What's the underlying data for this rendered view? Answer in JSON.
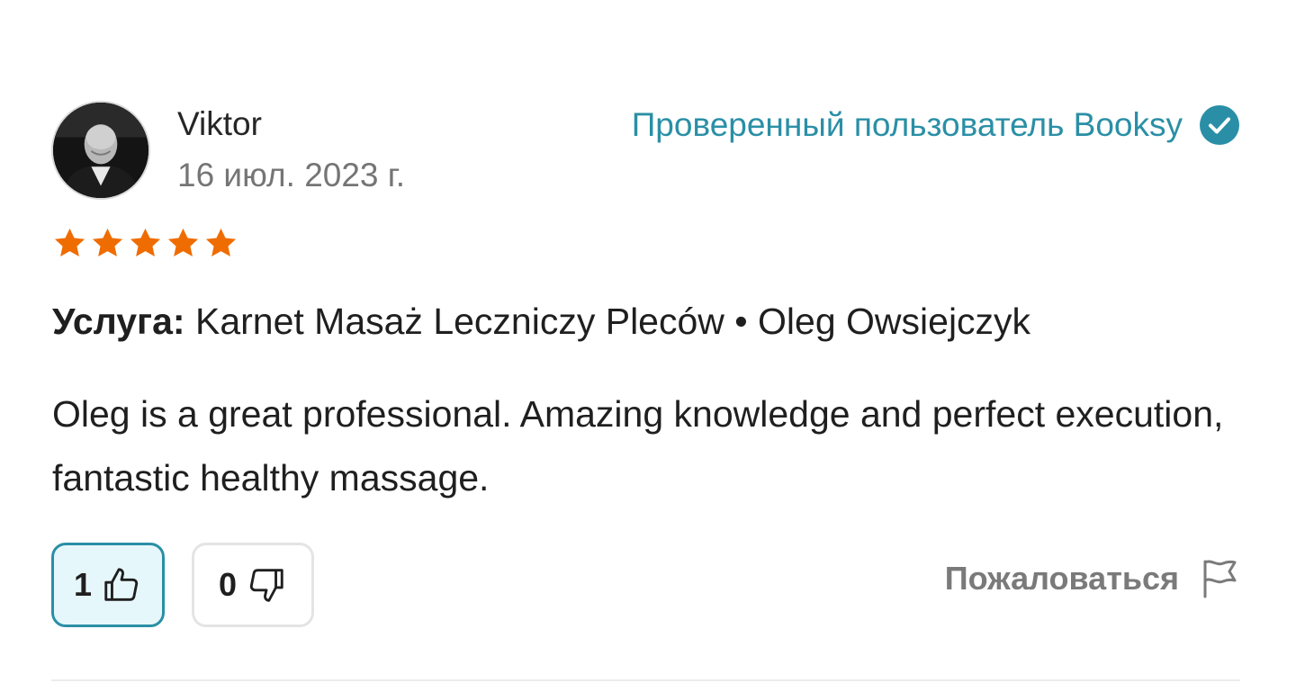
{
  "review": {
    "user_name": "Viktor",
    "date": "16 июл. 2023 г.",
    "verified_label": "Проверенный пользователь Booksy",
    "rating": 5,
    "rating_max": 5,
    "service_label": "Услуга:",
    "service_value": "Karnet Masaż Leczniczy Pleców • Oleg Owsiejczyk",
    "text": "Oleg is a great professional. Amazing knowledge and perfect execution, fantastic healthy massage.",
    "helpful_count": "1",
    "unhelpful_count": "0",
    "report_label": "Пожаловаться"
  },
  "colors": {
    "accent": "#2a8fa6",
    "star": "#ef6c00",
    "upvote_bg": "#e6f7fb",
    "muted_text": "#757575"
  },
  "icons": {
    "verified": "check-circle-icon",
    "star": "star-icon",
    "thumbs_up": "thumbs-up-icon",
    "thumbs_down": "thumbs-down-icon",
    "report": "flag-icon"
  }
}
